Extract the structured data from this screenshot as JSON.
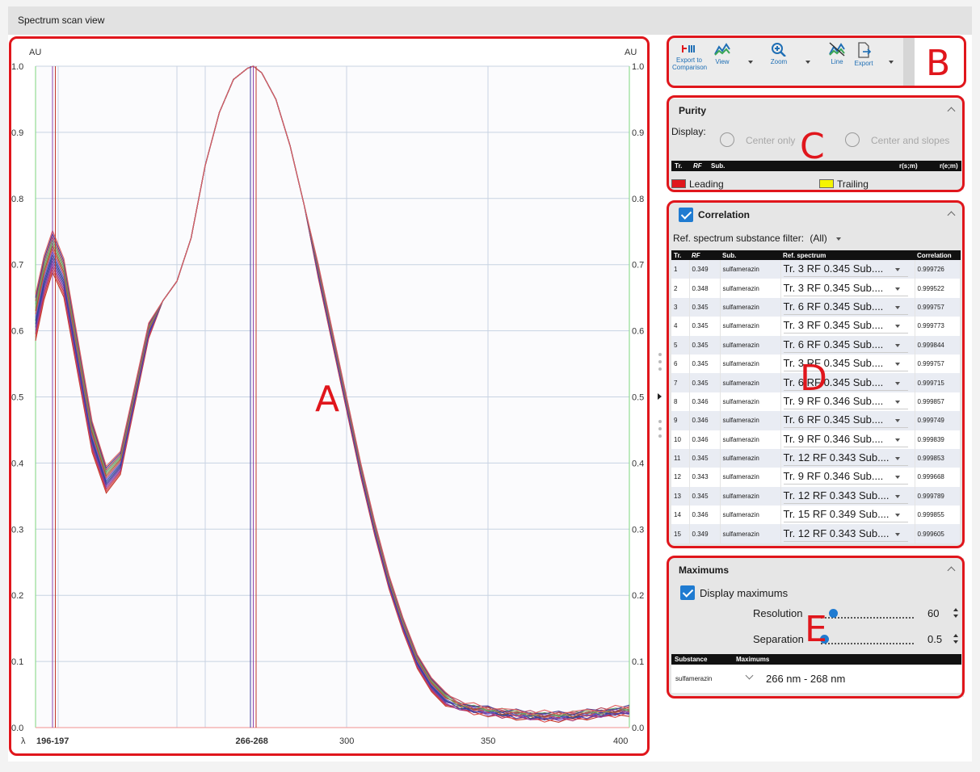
{
  "window": {
    "title": "Spectrum scan view"
  },
  "callouts": {
    "a": "A",
    "b": "B",
    "c": "C",
    "d": "D",
    "e": "E"
  },
  "chart": {
    "y_unit_left": "AU",
    "y_unit_right": "AU",
    "lambda_symbol": "λ",
    "marker_label_1": "196-197",
    "marker_label_2": "266-268",
    "x_tick_300": "300",
    "x_tick_350": "350",
    "x_tick_400": "400"
  },
  "chart_data": {
    "type": "line",
    "xlim": [
      190,
      400
    ],
    "ylim": [
      0.0,
      1.0
    ],
    "y_ticks": [
      "0.0",
      "0.1",
      "0.2",
      "0.3",
      "0.4",
      "0.5",
      "0.6",
      "0.7",
      "0.8",
      "0.9",
      "1.0"
    ],
    "x_ticks": [
      300,
      350,
      400
    ],
    "marker_ranges": [
      [
        196,
        197
      ],
      [
        266,
        268
      ]
    ],
    "grid": true,
    "series_count": 15,
    "x": [
      190,
      193,
      196,
      200,
      205,
      210,
      215,
      220,
      225,
      230,
      235,
      240,
      245,
      250,
      255,
      260,
      265,
      267,
      270,
      275,
      280,
      285,
      290,
      295,
      300,
      305,
      310,
      315,
      320,
      325,
      330,
      335,
      340,
      345,
      350,
      355,
      360,
      365,
      370,
      375,
      380,
      385,
      390,
      395,
      400
    ],
    "base_values": [
      0.62,
      0.68,
      0.72,
      0.68,
      0.56,
      0.44,
      0.375,
      0.4,
      0.5,
      0.6,
      0.645,
      0.675,
      0.74,
      0.85,
      0.93,
      0.98,
      0.997,
      1.0,
      0.99,
      0.95,
      0.88,
      0.79,
      0.69,
      0.59,
      0.49,
      0.39,
      0.3,
      0.22,
      0.155,
      0.1,
      0.065,
      0.043,
      0.033,
      0.028,
      0.025,
      0.022,
      0.02,
      0.018,
      0.017,
      0.017,
      0.018,
      0.02,
      0.022,
      0.024,
      0.026
    ],
    "colors": [
      "#c0392b",
      "#d94a4a",
      "#b03060",
      "#8e44ad",
      "#5b3fa0",
      "#3d3d9e",
      "#2e4a8e",
      "#6a5acd",
      "#cc5555",
      "#a0522d",
      "#7d9f5a",
      "#5f9e6e",
      "#b5485d",
      "#4b3b8f",
      "#e06060"
    ]
  },
  "toolbar": {
    "export_comparison": "Export to Comparison",
    "view": "View",
    "zoom": "Zoom",
    "line": "Line",
    "export": "Export"
  },
  "purity": {
    "title": "Purity",
    "display_label": "Display:",
    "option_center": "Center only",
    "option_slopes": "Center and slopes",
    "col_tr": "Tr.",
    "col_rf": "RF",
    "col_sub": "Sub.",
    "col_rsm": "r(s;m)",
    "col_rem": "r(e;m)",
    "legend_leading": "Leading",
    "legend_trailing": "Trailing",
    "leading_color": "#e0161c",
    "trailing_color": "#f5f500"
  },
  "correlation": {
    "title": "Correlation",
    "filter_label": "Ref. spectrum substance filter:",
    "filter_value": "(All)",
    "columns": [
      "Tr.",
      "RF",
      "Sub.",
      "Ref. spectrum",
      "Correlation"
    ],
    "rows": [
      {
        "tr": "1",
        "rf": "0.349",
        "sub": "sulfamerazin",
        "ref": "Tr. 3 RF 0.345 Sub....",
        "corr": "0.999726"
      },
      {
        "tr": "2",
        "rf": "0.348",
        "sub": "sulfamerazin",
        "ref": "Tr. 3 RF 0.345 Sub....",
        "corr": "0.999522"
      },
      {
        "tr": "3",
        "rf": "0.345",
        "sub": "sulfamerazin",
        "ref": "Tr. 6 RF 0.345 Sub....",
        "corr": "0.999757"
      },
      {
        "tr": "4",
        "rf": "0.345",
        "sub": "sulfamerazin",
        "ref": "Tr. 3 RF 0.345 Sub....",
        "corr": "0.999773"
      },
      {
        "tr": "5",
        "rf": "0.345",
        "sub": "sulfamerazin",
        "ref": "Tr. 6 RF 0.345 Sub....",
        "corr": "0.999844"
      },
      {
        "tr": "6",
        "rf": "0.345",
        "sub": "sulfamerazin",
        "ref": "Tr. 3 RF 0.345 Sub....",
        "corr": "0.999757"
      },
      {
        "tr": "7",
        "rf": "0.345",
        "sub": "sulfamerazin",
        "ref": "Tr. 6 RF 0.345 Sub....",
        "corr": "0.999715"
      },
      {
        "tr": "8",
        "rf": "0.346",
        "sub": "sulfamerazin",
        "ref": "Tr. 9 RF 0.346 Sub....",
        "corr": "0.999857"
      },
      {
        "tr": "9",
        "rf": "0.346",
        "sub": "sulfamerazin",
        "ref": "Tr. 6 RF 0.345 Sub....",
        "corr": "0.999749"
      },
      {
        "tr": "10",
        "rf": "0.346",
        "sub": "sulfamerazin",
        "ref": "Tr. 9 RF 0.346 Sub....",
        "corr": "0.999839"
      },
      {
        "tr": "11",
        "rf": "0.345",
        "sub": "sulfamerazin",
        "ref": "Tr. 12 RF 0.343 Sub....",
        "corr": "0.999853"
      },
      {
        "tr": "12",
        "rf": "0.343",
        "sub": "sulfamerazin",
        "ref": "Tr. 9 RF 0.346 Sub....",
        "corr": "0.999668"
      },
      {
        "tr": "13",
        "rf": "0.345",
        "sub": "sulfamerazin",
        "ref": "Tr. 12 RF 0.343 Sub....",
        "corr": "0.999789"
      },
      {
        "tr": "14",
        "rf": "0.346",
        "sub": "sulfamerazin",
        "ref": "Tr. 15 RF 0.349 Sub....",
        "corr": "0.999855"
      },
      {
        "tr": "15",
        "rf": "0.349",
        "sub": "sulfamerazin",
        "ref": "Tr. 12 RF 0.343 Sub....",
        "corr": "0.999605"
      }
    ]
  },
  "maximums": {
    "title": "Maximums",
    "display_label": "Display maximums",
    "resolution_label": "Resolution",
    "resolution_value": "60",
    "separation_label": "Separation",
    "separation_value": "0.5",
    "col_substance": "Substance",
    "col_maximums": "Maximums",
    "row_substance": "sulfamerazin",
    "row_maximums": "266 nm - 268 nm"
  }
}
